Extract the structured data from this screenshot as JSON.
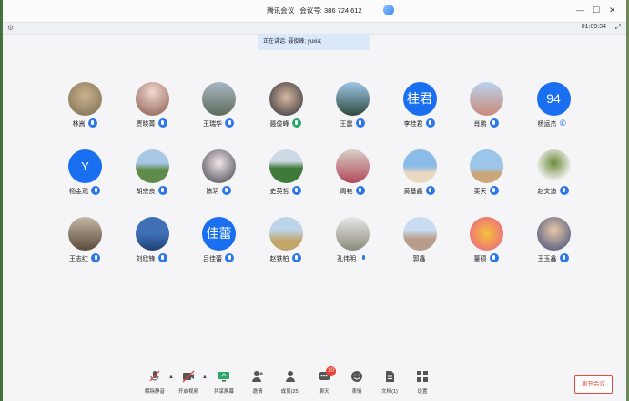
{
  "window": {
    "app_name": "腾讯会议",
    "meeting_label": "会议号:",
    "meeting_id": "386 724 612",
    "minimize_glyph": "—",
    "maximize_glyph": "☐",
    "close_glyph": "✕"
  },
  "status": {
    "timer": "01:09:34",
    "fullscreen_glyph": "⤢",
    "settings_glyph": "⚙"
  },
  "speaking_banner": "正在讲话: 聂俊峰; yuxia;",
  "colors": {
    "accent": "#1a6ff0",
    "leave": "#e54a3f",
    "badge": "#e8413a"
  },
  "participants": [
    {
      "name": "林嵩",
      "avatar": "photo-sepia",
      "mic": "active"
    },
    {
      "name": "贾晓菁",
      "avatar": "photo-flowers",
      "mic": "active"
    },
    {
      "name": "王瑞华",
      "avatar": "photo-building",
      "mic": "active"
    },
    {
      "name": "聂俊峰",
      "avatar": "photo-man",
      "mic": "speaking"
    },
    {
      "name": "王震",
      "avatar": "photo-palms",
      "mic": "active"
    },
    {
      "name": "李桂君",
      "avatar": "text",
      "avatar_text": "桂君",
      "mic": "active"
    },
    {
      "name": "肖鹏",
      "avatar": "photo-child",
      "mic": "active"
    },
    {
      "name": "杨运杰",
      "avatar": "text",
      "avatar_text": "94",
      "mic": "phone"
    },
    {
      "name": "杨金观",
      "avatar": "text",
      "avatar_text": "Y",
      "mic": "active"
    },
    {
      "name": "胡宗良",
      "avatar": "photo-lake",
      "mic": "active"
    },
    {
      "name": "陈玥",
      "avatar": "photo-bride",
      "mic": "active"
    },
    {
      "name": "史英哲",
      "avatar": "photo-field",
      "mic": "active"
    },
    {
      "name": "周艳",
      "avatar": "photo-woman",
      "mic": "active"
    },
    {
      "name": "黄基鑫",
      "avatar": "photo-beach",
      "mic": "active"
    },
    {
      "name": "栾天",
      "avatar": "photo-sky",
      "mic": "active"
    },
    {
      "name": "赵文迪",
      "avatar": "photo-statue",
      "mic": "active"
    },
    {
      "name": "王志红",
      "avatar": "photo-group",
      "mic": "active"
    },
    {
      "name": "刘欣锋",
      "avatar": "photo-city",
      "mic": "active"
    },
    {
      "name": "吕佳蕾",
      "avatar": "text",
      "avatar_text": "佳蕾",
      "mic": "active"
    },
    {
      "name": "赵铁柏",
      "avatar": "photo-giraffe",
      "mic": "active"
    },
    {
      "name": "孔伟明",
      "avatar": "photo-sit",
      "mic": "plain"
    },
    {
      "name": "郭鑫",
      "avatar": "photo-temple",
      "mic": "none"
    },
    {
      "name": "董硕",
      "avatar": "photo-cartoon",
      "mic": "active"
    },
    {
      "name": "王玉鑫",
      "avatar": "photo-girl",
      "mic": "active"
    }
  ],
  "bottom_bar": {
    "unmute": "解除静音",
    "video": "开启视频",
    "share": "共享屏幕",
    "invite": "邀请",
    "members": "成员(25)",
    "chat": "聊天",
    "chat_badge": "10",
    "reaction": "表情",
    "docs": "文档(1)",
    "settings": "设置",
    "leave": "离开会议"
  }
}
